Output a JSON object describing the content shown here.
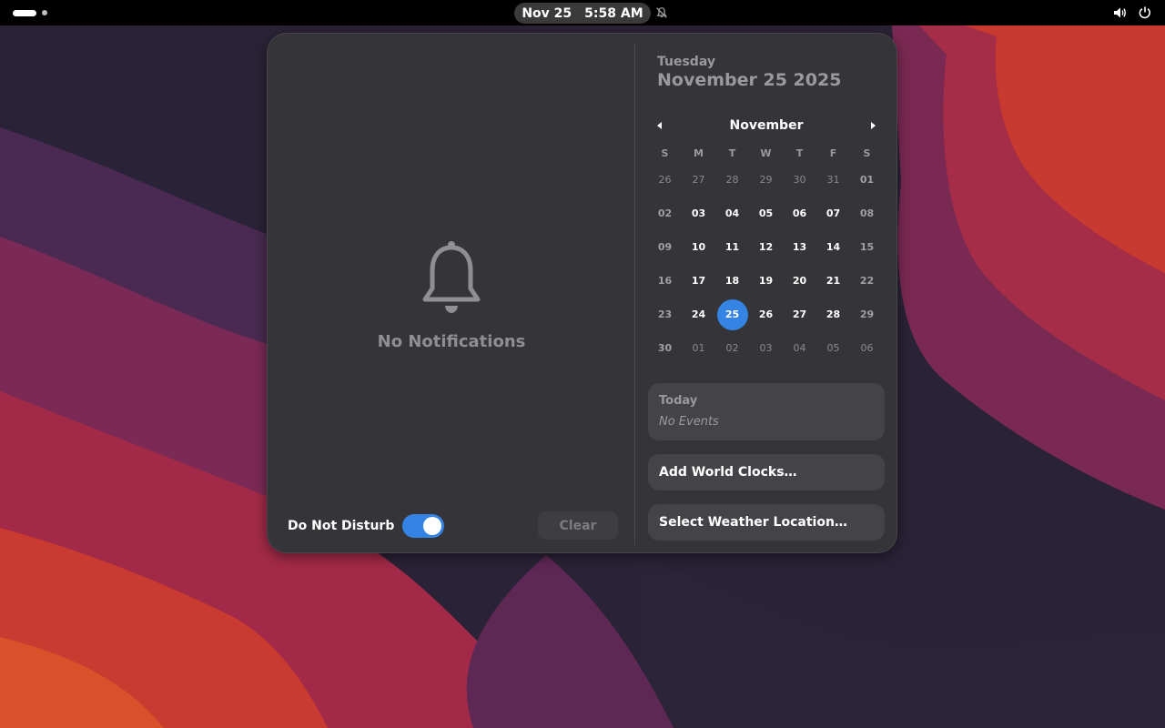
{
  "topbar": {
    "clock_date": "Nov 25",
    "clock_time": "5:58 AM",
    "dnd_indicator_icon": "bell-off-icon",
    "tray_icons": [
      "volume-icon",
      "power-icon"
    ]
  },
  "notifications": {
    "empty_icon": "bell-icon",
    "empty_label": "No Notifications",
    "dnd_label": "Do Not Disturb",
    "dnd_enabled": true,
    "clear_label": "Clear"
  },
  "calendar": {
    "weekday": "Tuesday",
    "full_date": "November 25 2025",
    "month": "November",
    "prev_icon": "chevron-left-icon",
    "next_icon": "chevron-right-icon",
    "day_headers": [
      "S",
      "M",
      "T",
      "W",
      "T",
      "F",
      "S"
    ],
    "weeks": [
      [
        "26",
        "27",
        "28",
        "29",
        "30",
        "31",
        "01"
      ],
      [
        "02",
        "03",
        "04",
        "05",
        "06",
        "07",
        "08"
      ],
      [
        "09",
        "10",
        "11",
        "12",
        "13",
        "14",
        "15"
      ],
      [
        "16",
        "17",
        "18",
        "19",
        "20",
        "21",
        "22"
      ],
      [
        "23",
        "24",
        "25",
        "26",
        "27",
        "28",
        "29"
      ],
      [
        "30",
        "01",
        "02",
        "03",
        "04",
        "05",
        "06"
      ]
    ],
    "selected_day": "25"
  },
  "events": {
    "title": "Today",
    "empty": "No Events"
  },
  "world_clocks": {
    "label": "Add World Clocks…"
  },
  "weather": {
    "label": "Select Weather Location…"
  },
  "colors": {
    "accent": "#3584e4",
    "popover_bg": "#353539",
    "card_bg": "#444448"
  }
}
